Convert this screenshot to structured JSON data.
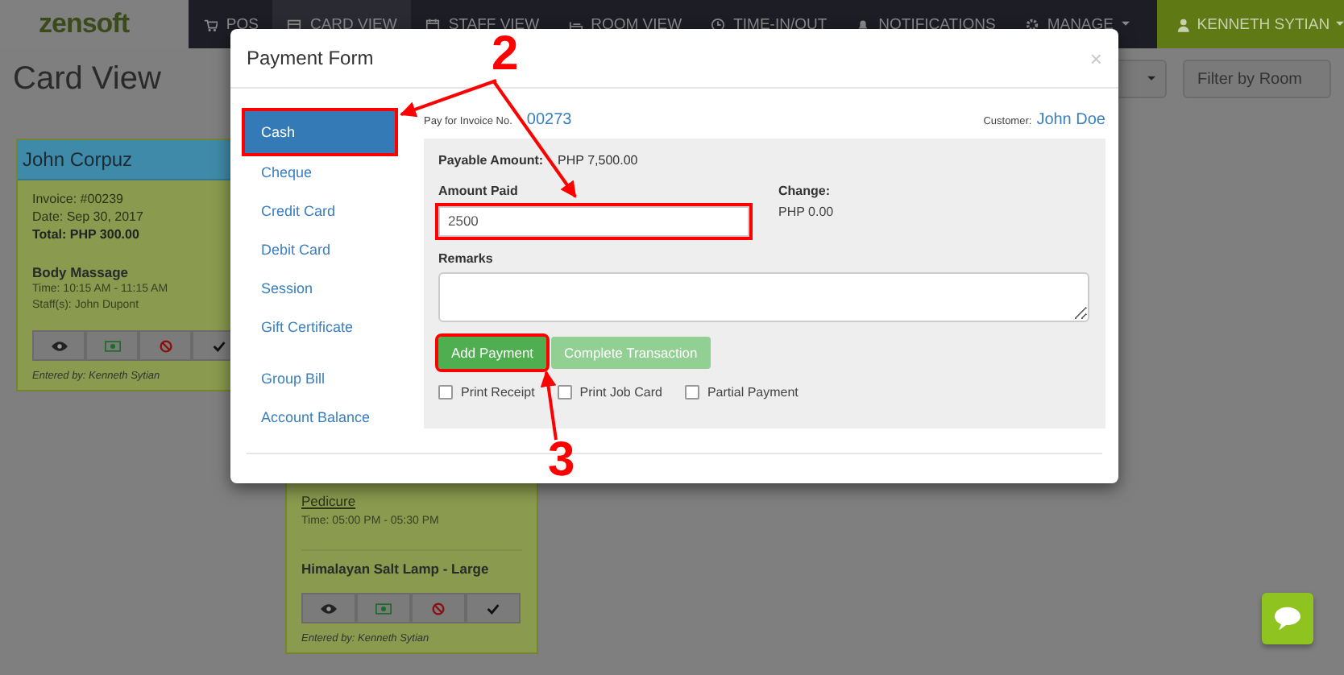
{
  "navbar": {
    "logo": "zensoft",
    "items": [
      {
        "label": "POS",
        "selected": false
      },
      {
        "label": "CARD VIEW",
        "selected": true
      },
      {
        "label": "STAFF VIEW",
        "selected": false
      },
      {
        "label": "ROOM VIEW",
        "selected": false
      },
      {
        "label": "TIME-IN/OUT",
        "selected": false
      },
      {
        "label": "NOTIFICATIONS",
        "selected": false
      },
      {
        "label": "MANAGE",
        "selected": false
      }
    ],
    "user": "KENNETH SYTIAN"
  },
  "page_title": "Card View",
  "filters": [
    "Filter by Room"
  ],
  "cards": [
    {
      "customer": "John Corpuz",
      "lines": [
        "Invoice: #00239",
        "Date: Sep 30, 2017"
      ],
      "total": "Total: PHP 300.00",
      "service": "Body Massage",
      "details": [
        "Time: 10:15 AM - 11:15 AM",
        "Staff(s): John Dupont"
      ],
      "entered": "Entered by: Kenneth Sytian"
    },
    {
      "service_link": "Pedicure",
      "details": [
        "Time: 05:00 PM - 05:30 PM"
      ],
      "product": "Himalayan Salt Lamp - Large",
      "entered": "Entered by: Kenneth Sytian"
    }
  ],
  "modal": {
    "title": "Payment Form",
    "close": "×",
    "method_groups": [
      [
        {
          "label": "Cash",
          "selected": true,
          "annotated": true
        },
        {
          "label": "Cheque",
          "selected": false,
          "annotated": false
        },
        {
          "label": "Credit Card",
          "selected": false,
          "annotated": false
        },
        {
          "label": "Debit Card",
          "selected": false,
          "annotated": false
        },
        {
          "label": "Session",
          "selected": false,
          "annotated": false
        },
        {
          "label": "Gift Certificate",
          "selected": false,
          "annotated": false
        }
      ],
      [
        {
          "label": "Group Bill",
          "selected": false,
          "annotated": false
        },
        {
          "label": "Account Balance",
          "selected": false,
          "annotated": false
        }
      ]
    ],
    "invoice_label": "Pay for Invoice No.",
    "invoice_no": "00273",
    "customer_label": "Customer:",
    "customer": "John Doe",
    "payable_label": "Payable Amount:",
    "payable": "PHP 7,500.00",
    "amount_label": "Amount Paid",
    "amount_value": "2500",
    "amount_annotated": true,
    "change_label": "Change:",
    "change": "PHP 0.00",
    "remarks_label": "Remarks",
    "buttons": [
      {
        "label": "Add Payment",
        "disabled": false,
        "annotated": true
      },
      {
        "label": "Complete Transaction",
        "disabled": true,
        "annotated": false
      }
    ],
    "options": [
      {
        "label": "Print Receipt",
        "checked": false
      },
      {
        "label": "Print Job Card",
        "checked": false
      },
      {
        "label": "Partial Payment",
        "checked": false
      }
    ]
  },
  "annotations": [
    {
      "label": "2"
    },
    {
      "label": "3"
    }
  ]
}
